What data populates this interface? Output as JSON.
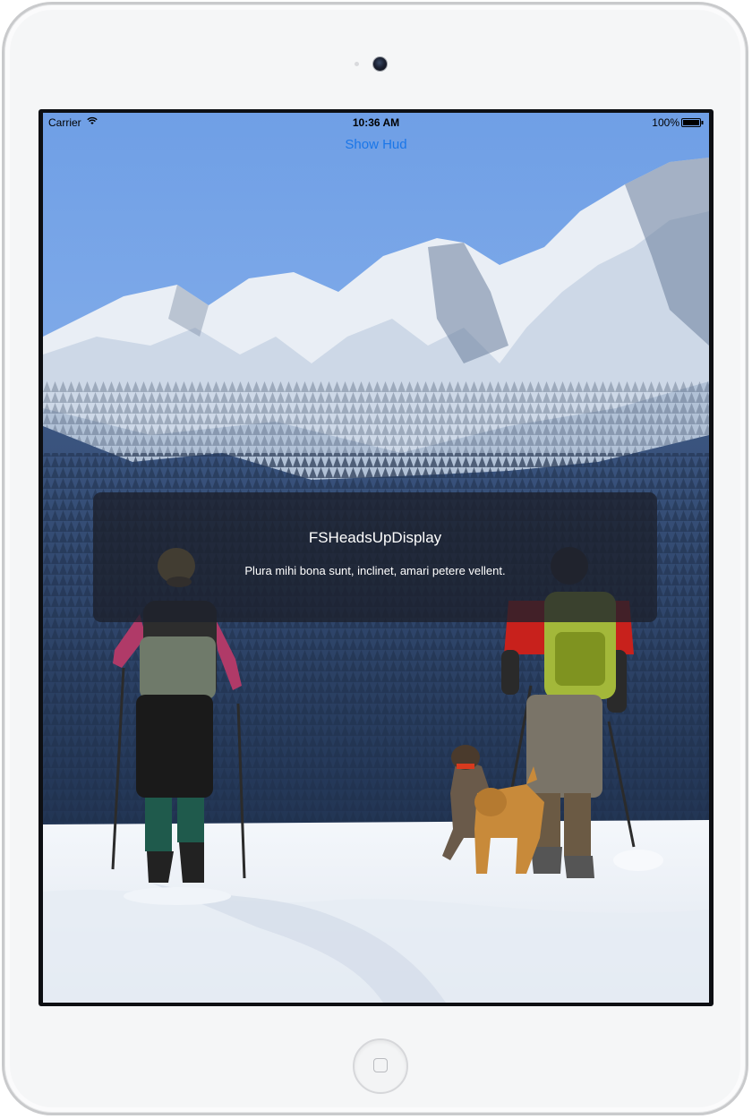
{
  "status_bar": {
    "carrier": "Carrier",
    "time": "10:36 AM",
    "battery": "100%"
  },
  "nav": {
    "show_hud_label": "Show Hud"
  },
  "hud": {
    "title": "FSHeadsUpDisplay",
    "message": "Plura mihi bona sunt, inclinet, amari petere vellent."
  },
  "icons": {
    "wifi": "wifi-icon",
    "battery": "battery-icon",
    "camera": "camera-icon",
    "home": "home-button-icon"
  },
  "colors": {
    "link": "#1a76e8",
    "hud_background": "#1c202c",
    "sky": "#7fa9e8"
  }
}
